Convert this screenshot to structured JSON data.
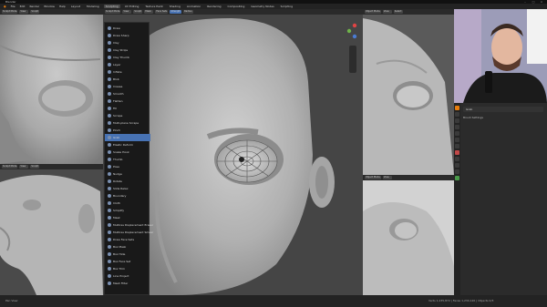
{
  "app": {
    "title": "Blender",
    "menus": [
      "File",
      "Edit",
      "Render",
      "Window",
      "Help"
    ],
    "workspaces": [
      "Layout",
      "Modeling",
      "Sculpting",
      "UV Editing",
      "Texture Paint",
      "Shading",
      "Animation",
      "Rendering",
      "Compositing",
      "Geometry Nodes",
      "Scripting"
    ],
    "active_workspace": "Sculpting"
  },
  "viewports": {
    "top_left_header": [
      "Sculpt Mode",
      "View",
      "Sculpt",
      "Mask",
      "Face Sets"
    ],
    "bottom_left_header": [
      "Sculpt Mode",
      "View",
      "Sculpt"
    ],
    "center_header": [
      "Sculpt Mode",
      "View",
      "Sculpt",
      "Mask",
      "Face Sets",
      "Strength",
      "Radius"
    ],
    "right_top_header": [
      "Object Mode",
      "View",
      "Select"
    ],
    "right_bottom_header": [
      "Object Mode",
      "View"
    ]
  },
  "brush_menu": {
    "items": [
      "Draw",
      "Draw Sharp",
      "Clay",
      "Clay Strips",
      "Clay Thumb",
      "Layer",
      "Inflate",
      "Blob",
      "Crease",
      "Smooth",
      "Flatten",
      "Fill",
      "Scrape",
      "Multi-plane Scrape",
      "Pinch",
      "Grab",
      "Elastic Deform",
      "Snake Hook",
      "Thumb",
      "Pose",
      "Nudge",
      "Rotate",
      "Slide Relax",
      "Boundary",
      "Cloth",
      "Simplify",
      "Mask",
      "Multires Displacement Eraser",
      "Multires Displacement Smear",
      "Draw Face Sets",
      "Box Mask",
      "Box Hide",
      "Box Face Set",
      "Box Trim",
      "Line Project",
      "Mesh Filter"
    ],
    "selected": "Grab"
  },
  "properties": {
    "object_label": "Grab",
    "section_label": "Brush Settings"
  },
  "statusbar": {
    "left": "Pan View",
    "right": "Verts 1,235,872 | Faces 1,234,120 | Objects 0/3"
  },
  "colors": {
    "accent": "#4772b3",
    "viewport_bg": "#3b3b3b",
    "menu_bg": "#191919",
    "header_bg": "#2a2a2a"
  }
}
